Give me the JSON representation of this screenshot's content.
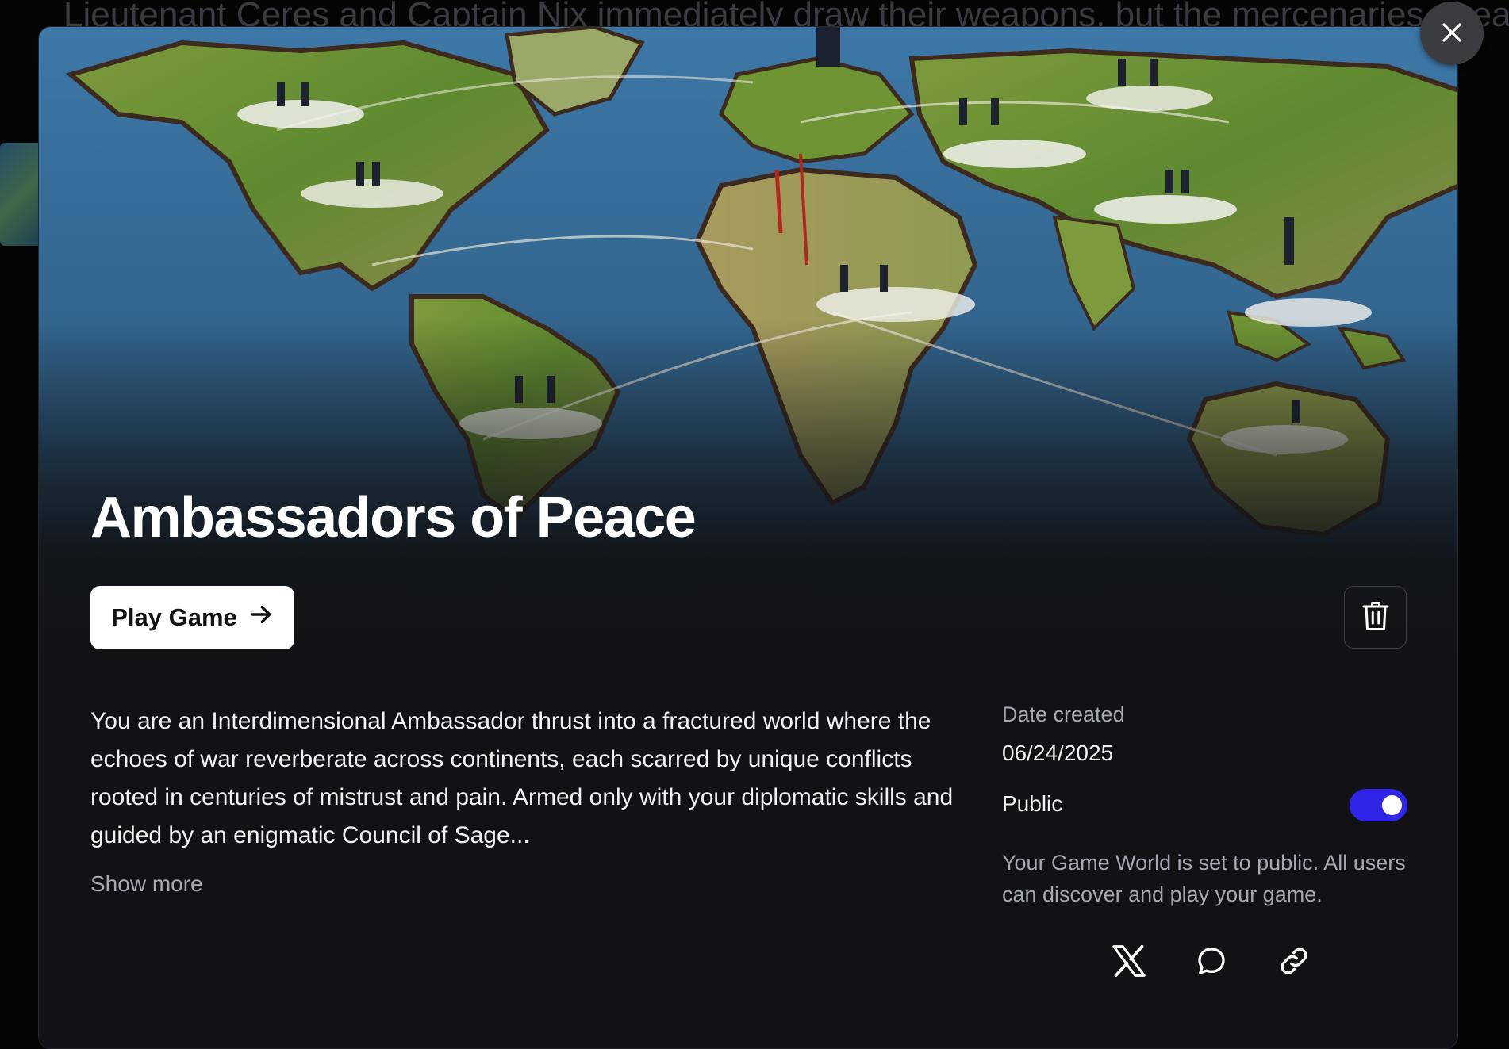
{
  "background": {
    "story_text": "Lieutenant Ceres and Captain Nix immediately draw their weapons, but the mercenaries already"
  },
  "game": {
    "title": "Ambassadors of Peace",
    "play_label": "Play Game",
    "description": "You are an Interdimensional Ambassador thrust into a fractured world where the echoes of war reverberate across continents, each scarred by unique conflicts rooted in centuries of mistrust and pain. Armed only with your diplomatic skills and guided by an enigmatic Council of Sage...",
    "show_more_label": "Show more"
  },
  "details": {
    "date_label": "Date created",
    "date_value": "06/24/2025",
    "public_label": "Public",
    "public_enabled": true,
    "public_note": "Your Game World is set to public. All users can discover and play your game."
  },
  "icons": {
    "close": "close-icon",
    "play_arrow": "arrow-right-icon",
    "delete": "trash-icon",
    "share_x": "x-logo-icon",
    "share_chat": "chat-bubble-icon",
    "share_link": "link-icon"
  },
  "colors": {
    "modal_bg": "#111215",
    "toggle_on": "#2f24e8",
    "muted_text": "#a4a8b2"
  }
}
